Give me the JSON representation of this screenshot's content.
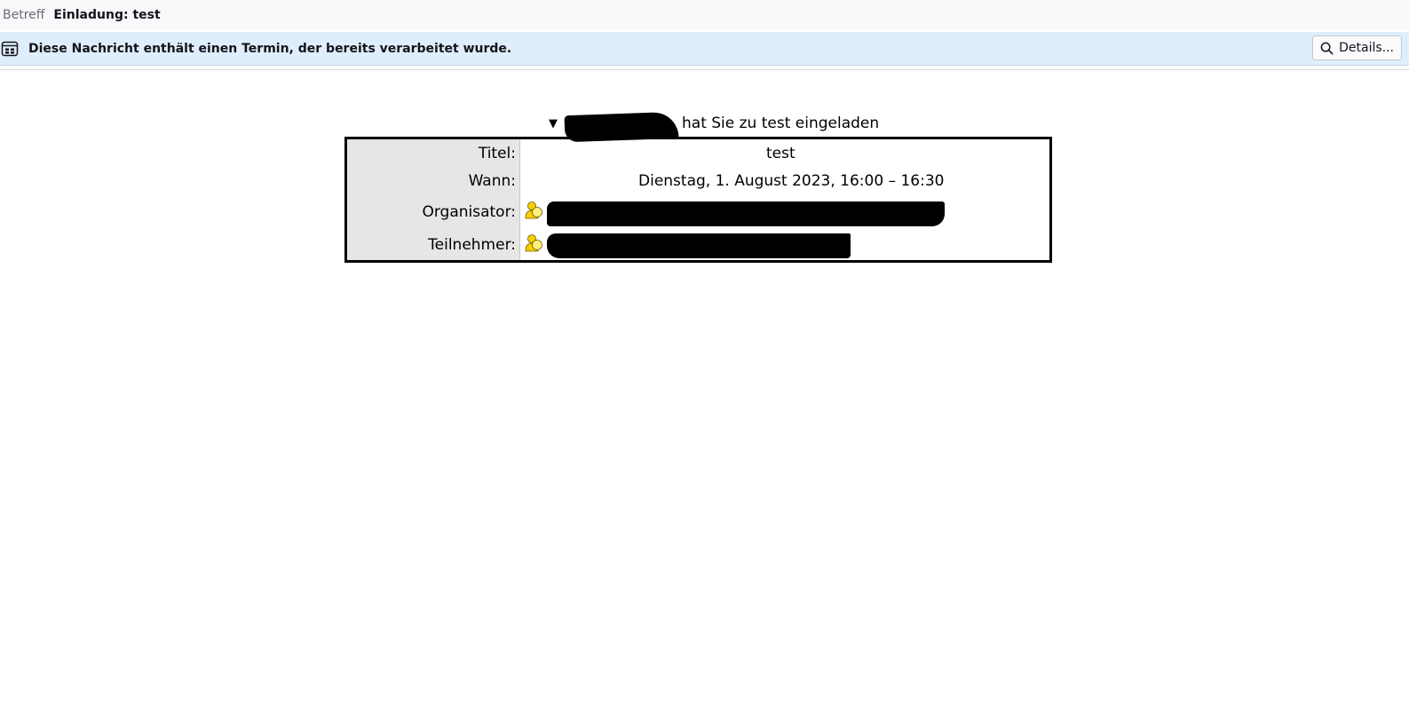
{
  "subject": {
    "label": "Betreff",
    "value": "Einladung: test"
  },
  "notification": {
    "text": "Diese Nachricht enthält einen Termin, der bereits verarbeitet wurde.",
    "details_label": "Details..."
  },
  "invitation": {
    "toggle_symbol": "▼",
    "summary_suffix": "hat Sie zu test eingeladen",
    "rows": {
      "title_label": "Titel:",
      "title_value": "test",
      "when_label": "Wann:",
      "when_value": "Dienstag, 1. August 2023, 16:00 – 16:30",
      "organizer_label": "Organisator:",
      "attendee_label": "Teilnehmer:"
    }
  },
  "icons": {
    "calendar": "calendar-icon",
    "search": "search-icon",
    "person": "person-icon"
  },
  "colors": {
    "notification_bg": "#deeefc",
    "label_col_bg": "#e6e6e6",
    "person_icon": "#f5d000"
  }
}
